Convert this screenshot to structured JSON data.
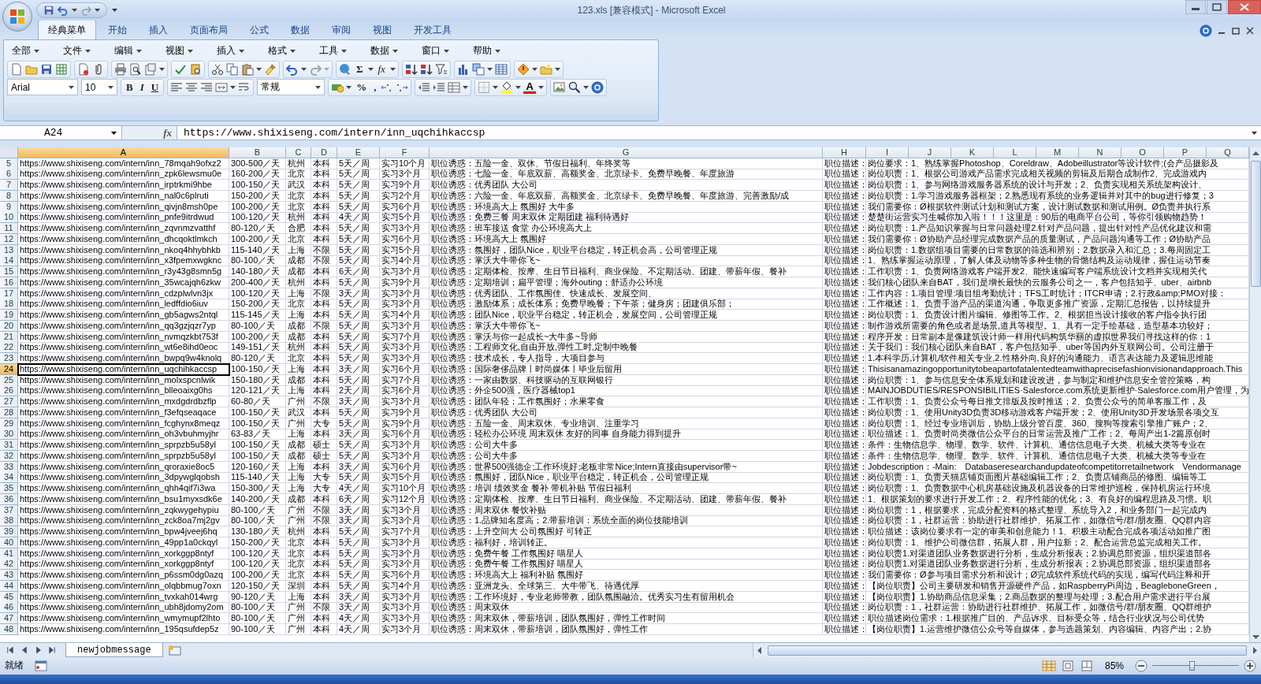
{
  "window": {
    "title": "123.xls  [兼容模式] - Microsoft Excel"
  },
  "ribbon_tabs": [
    {
      "label": "经典菜单",
      "selected": true
    },
    {
      "label": "开始",
      "selected": false
    },
    {
      "label": "插入",
      "selected": false
    },
    {
      "label": "页面布局",
      "selected": false
    },
    {
      "label": "公式",
      "selected": false
    },
    {
      "label": "数据",
      "selected": false
    },
    {
      "label": "审阅",
      "selected": false
    },
    {
      "label": "视图",
      "selected": false
    },
    {
      "label": "开发工具",
      "selected": false
    }
  ],
  "menus": [
    "全部",
    "文件",
    "编辑",
    "视图",
    "插入",
    "格式",
    "工具",
    "数据",
    "窗口",
    "帮助"
  ],
  "toolbar": {
    "sum": "Σ",
    "function": "fx",
    "font": "Arial",
    "font_size": "10",
    "bold": "B",
    "italic": "I",
    "underline": "U",
    "number_format": "常规",
    "percent": "%",
    "comma": ",",
    "font_color": "A"
  },
  "formula_bar": {
    "name_box": "A24",
    "fx": "fx",
    "formula": "https://www.shixiseng.com/intern/inn_uqchihkaccsp"
  },
  "sheet": {
    "columns": [
      {
        "label": "A",
        "selected": true
      },
      {
        "label": "B",
        "selected": false
      },
      {
        "label": "C",
        "selected": false
      },
      {
        "label": "D",
        "selected": false
      },
      {
        "label": "E",
        "selected": false
      },
      {
        "label": "F",
        "selected": false
      },
      {
        "label": "G",
        "selected": false
      },
      {
        "label": "H",
        "selected": false
      },
      {
        "label": "I",
        "selected": false
      },
      {
        "label": "J",
        "selected": false
      },
      {
        "label": "K",
        "selected": false
      },
      {
        "label": "L",
        "selected": false
      },
      {
        "label": "M",
        "selected": false
      },
      {
        "label": "N",
        "selected": false
      },
      {
        "label": "O",
        "selected": false
      },
      {
        "label": "P",
        "selected": false
      },
      {
        "label": "Q",
        "selected": false
      }
    ],
    "rows": [
      {
        "number": "5",
        "selected": false,
        "cells": [
          "https://www.shixiseng.com/intern/inn_78mqah9ofxz2",
          "300-500／天",
          "杭州",
          "本科",
          "5天／周",
          "实习10个月",
          "职位诱惑：五险一金、双休、节假日福利、年终奖等",
          "职位描述：",
          "岗位要求：1、熟练掌握Photoshop、Coreldraw、Adobeillustrator等设计软件;(会产品摄影及"
        ]
      },
      {
        "number": "6",
        "selected": false,
        "cells": [
          "https://www.shixiseng.com/intern/inn_zpk6lewsmu0e",
          "160-200／天",
          "北京",
          "本科",
          "5天／周",
          "实习3个月",
          "职位诱惑：七险一金、年底双薪、高额奖金、北京绿卡、免费早晚餐、年度旅游",
          "职位描述：",
          "岗位职责：1、根据公司游戏产品需求完成相关视频的剪辑及后期合成制作2、完成游戏内"
        ]
      },
      {
        "number": "7",
        "selected": false,
        "cells": [
          "https://www.shixiseng.com/intern/inn_irptrkmi9hbe",
          "100-150／天",
          "武汉",
          "本科",
          "5天／周",
          "实习9个月",
          "职位诱惑：优秀团队 大公司",
          "职位描述：",
          "岗位职责：1、参与网络游戏服务器系统的设计与开发；2、负责实现相关系统架构设计、"
        ]
      },
      {
        "number": "8",
        "selected": false,
        "cells": [
          "https://www.shixiseng.com/intern/inn_nal0c6plruti",
          "150-200／天",
          "北京",
          "本科",
          "5天／周",
          "实习2个月",
          "职位诱惑：六险一金、年底双薪、高额奖金、北京绿卡、免费早晚餐、年度旅游、完善激励/成",
          "职位描述：",
          "岗位职责：1.学习游戏服务器框架；2.熟悉现有系统的业务逻辑并对其中的bug进行修复；3"
        ]
      },
      {
        "number": "9",
        "selected": false,
        "cells": [
          "https://www.shixiseng.com/intern/inn_qivjn8msh0pe",
          "100-200／天",
          "北京",
          "本科",
          "5天／周",
          "实习6个月",
          "职位诱惑：环境高大上 氛围好 大牛多",
          "职位描述：",
          "我们需要你：Ø根据软件测试计划和测试方案，设计测试数据和测试用例。Ø负责并执行系"
        ]
      },
      {
        "number": "10",
        "selected": false,
        "cells": [
          "https://www.shixiseng.com/intern/inn_pnfe9itrdwud",
          "100-120／天",
          "杭州",
          "本科",
          "4天／周",
          "实习5个月",
          "职位诱惑：免费三餐 周末双休 定期团建 福利待遇好",
          "职位描述：",
          "楚楚街运营实习生喊你加入啦！！！这里是：90后的电商平台公司，等你引领购物趋势！"
        ]
      },
      {
        "number": "11",
        "selected": false,
        "cells": [
          "https://www.shixiseng.com/intern/inn_zqvnmzvatthf",
          "80-120／天",
          "合肥",
          "本科",
          "5天／周",
          "实习3个月",
          "职位诱惑：班车接送 食堂 办公环境高大上",
          "职位描述：",
          "岗位职责：1.产品知识掌握与日常问题处理2.针对产品问题，提出针对性产品优化建议和需"
        ]
      },
      {
        "number": "12",
        "selected": false,
        "cells": [
          "https://www.shixiseng.com/intern/inn_dhcqoktlmkch",
          "100-200／天",
          "北京",
          "本科",
          "5天／周",
          "实习6个月",
          "职位诱惑：环境高大上 氛围好",
          "职位描述：",
          "我们需要你：Ø协助产品经理完成数据产品的质量测试，产品问题沟通等工作；Ø协助产品"
        ]
      },
      {
        "number": "13",
        "selected": false,
        "cells": [
          "https://www.shixiseng.com/intern/inn_nkoq4hhybhkb",
          "115-140／天",
          "上海",
          "不限",
          "5天／周",
          "实习5个月",
          "职位诱惑：氛围好，团队Nice，职业平台稳定，转正机会高，公司管理正规",
          "职位描述：",
          "岗位职责：1.数据组项目需要的日常数据的筛选和辨别；2.数据录入和汇总；3.每周固定工"
        ]
      },
      {
        "number": "14",
        "selected": false,
        "cells": [
          "https://www.shixiseng.com/intern/inn_x3fpemxwgknc",
          "80-100／天",
          "成都",
          "不限",
          "5天／周",
          "实习4个月",
          "职位诱惑：掌沃大牛带你飞~",
          "职位描述：",
          "1、熟练掌握运动原理，了解人体及动物等多种生物的骨骼结构及运动规律，握住运动节奏"
        ]
      },
      {
        "number": "15",
        "selected": false,
        "cells": [
          "https://www.shixiseng.com/intern/inn_r3y43g8smn5g",
          "140-180／天",
          "成都",
          "本科",
          "6天／周",
          "实习3个月",
          "职位诱惑：定期体检、按摩、生日节日福利、商业保险、不定期活动、团建、带薪年假、餐补",
          "职位描述：",
          "工作职责：1、负责网络游戏客户端开发2、能快速编写客户端系统设计文档并实现相关代"
        ]
      },
      {
        "number": "16",
        "selected": false,
        "cells": [
          "https://www.shixiseng.com/intern/inn_35wcajqh6zkw",
          "200-400／天",
          "杭州",
          "本科",
          "5天／周",
          "实习9个月",
          "职位诱惑：定期培训；扁平管理；海外outing；舒适办公环境",
          "职位描述：",
          "我们核心团队来自BAT，我们是增长最快的云服务公司之一，客户包括知乎、uber、airbnb"
        ]
      },
      {
        "number": "17",
        "selected": false,
        "cells": [
          "https://www.shixiseng.com/intern/inn_cdzplwlvn3jx",
          "100-120／天",
          "上海",
          "不限",
          "3天／周",
          "实习3个月",
          "职位诱惑：优秀团队、工作氛围佳、快速成长、发展空间、",
          "职位描述：",
          "工作内容：1.项目管理:项目组考勤统计；TFS工时统计；ITCR申请；2.行政&amp;PMO对接："
        ]
      },
      {
        "number": "18",
        "selected": false,
        "cells": [
          "https://www.shixiseng.com/intern/inn_ledffdio6iuv",
          "150-200／天",
          "北京",
          "本科",
          "5天／周",
          "实习3个月",
          "职位诱惑：激励体系；成长体系；免费早晚餐；下午茶；健身房；团建俱乐部；",
          "职位描述：",
          "工作概述：1、负责手游产品的渠道沟通，争取更多推广资源，定期汇总报告，以持续提升"
        ]
      },
      {
        "number": "19",
        "selected": false,
        "cells": [
          "https://www.shixiseng.com/intern/inn_gb5agws2ntql",
          "115-145／天",
          "上海",
          "本科",
          "5天／周",
          "实习4个月",
          "职位诱惑：团队Nice，职业平台稳定，转正机会，发展空间，公司管理正规",
          "职位描述：",
          "岗位职责：1、负责设计图片编辑、修图等工作。2、根据担当设计接收的客户指令执行团"
        ]
      },
      {
        "number": "20",
        "selected": false,
        "cells": [
          "https://www.shixiseng.com/intern/inn_qq3gzjqzr7yp",
          "80-100／天",
          "成都",
          "不限",
          "5天／周",
          "实习3个月",
          "职位诱惑：掌沃大牛带你飞~",
          "职位描述：",
          "制作游戏所需要的角色或者是场景,道具等模型。1、具有一定手绘基础，造型基本功较好；"
        ]
      },
      {
        "number": "21",
        "selected": false,
        "cells": [
          "https://www.shixiseng.com/intern/inn_nvmqzkbt753f",
          "100-200／天",
          "成都",
          "本科",
          "5天／周",
          "实习7个月",
          "职位诱惑：掌沃与你一起成长~大牛多~导师",
          "职位描述：",
          "程序开发：日常副本是像建筑设计师一样用代码构筑华丽的虚拟世界我们寻找这样的你：1"
        ]
      },
      {
        "number": "22",
        "selected": false,
        "cells": [
          "https://www.shixiseng.com/intern/inn_wt6e8ihd0eoc",
          "149-151／天",
          "杭州",
          "本科",
          "5天／周",
          "实习3个月",
          "职位诱惑：工程师文化,自由开放,弹性工时,定制中晚餐",
          "职位描述：",
          "关于我们：我们核心团队来自BAT，客户包括知乎、uber等国内外互联网公司。公司注册于"
        ]
      },
      {
        "number": "23",
        "selected": false,
        "cells": [
          "https://www.shixiseng.com/intern/inn_bwpq9w4knolq",
          "80-120／天",
          "北京",
          "本科",
          "5天／周",
          "实习3个月",
          "职位诱惑：技术成长，专人指导，大项目参与",
          "职位描述：",
          "1.本科学历,计算机/软件相关专业,2.性格外向,良好的沟通能力、语言表达能力及逻辑思维能"
        ]
      },
      {
        "number": "24",
        "selected": true,
        "cells": [
          "https://www.shixiseng.com/intern/inn_uqchihkaccsp",
          "100-150／天",
          "上海",
          "本科",
          "3天／周",
          "实习6个月",
          "职位诱惑：国际奢侈品牌丨时尚媒体丨毕业后留用",
          "职位描述：",
          "Thisisanamazingopportunitytobeapartofatalentedteamwithaprecisefashionvisionandapproach.This"
        ]
      },
      {
        "number": "25",
        "selected": false,
        "cells": [
          "https://www.shixiseng.com/intern/inn_molxspcnlwik",
          "150-180／天",
          "成都",
          "本科",
          "5天／周",
          "实习7个月",
          "职位诱惑：一家由数据、科技驱动的互联网银行",
          "职位描述：",
          "岗位职责：1、参与信息安全体系规划和建设改进，参与制定和维护信息安全管控策略，构"
        ]
      },
      {
        "number": "26",
        "selected": false,
        "cells": [
          "https://www.shixiseng.com/intern/inn_blleoaixg0hs",
          "120-121／天",
          "上海",
          "本科",
          "2天／周",
          "实习6个月",
          "职位诱惑：外企500强，医疗器械top1",
          "职位描述：",
          "MAINJOBDUTIES/RESPONSIBILITIES·Salesforce.com系统更新维护·Salesforce.com用户管理，为"
        ]
      },
      {
        "number": "27",
        "selected": false,
        "cells": [
          "https://www.shixiseng.com/intern/inn_mxdgdrdbzflp",
          "60-80／天",
          "广州",
          "不限",
          "3天／周",
          "实习3个月",
          "职位诱惑：团队年轻；工作氛围好；水果零食",
          "职位描述：",
          "工作职责：1、负责公众号每日推文排版及按时推送；2、负责公众号的简单客服工作，及"
        ]
      },
      {
        "number": "28",
        "selected": false,
        "cells": [
          "https://www.shixiseng.com/intern/inn_f3efqseaqace",
          "100-150／天",
          "武汉",
          "本科",
          "5天／周",
          "实习9个月",
          "职位诱惑：优秀团队 大公司",
          "职位描述：",
          "岗位职责：1、使用Unity3D负责3D移动游戏客户端开发；2、使用Unity3D开发场景各项交互"
        ]
      },
      {
        "number": "29",
        "selected": false,
        "cells": [
          "https://www.shixiseng.com/intern/inn_fcghynx8meqz",
          "100-150／天",
          "广州",
          "大专",
          "5天／周",
          "实习9个月",
          "职位诱惑：五险一金、周末双休、专业培训、注重学习",
          "职位描述：",
          "岗位职责：1、经过专业培训后，协助上级分管百度、360、搜狗等搜索引擎推广账户；2、"
        ]
      },
      {
        "number": "30",
        "selected": false,
        "cells": [
          "https://www.shixiseng.com/intern/inn_oh3vbuhmyjhr",
          "63-83／天",
          "上海",
          "本科",
          "3天／周",
          "实习6个月",
          "职位诱惑：轻松办公环境 周末双休 友好的同事 自身能力得到提升",
          "职位描述：",
          "职位描述：1、负责时尚类微信公众平台的日常运营及推广工作；2、每周产出1-2篇原创时"
        ]
      },
      {
        "number": "31",
        "selected": false,
        "cells": [
          "https://www.shixiseng.com/intern/inn_sprpzb5u58yl",
          "100-150／天",
          "成都",
          "硕士",
          "5天／周",
          "实习3个月",
          "职位诱惑：公司大牛多",
          "职位描述：",
          "条件：生物信息学、物理、数学、软件、计算机、通信信息电子大类、机械大类等专业在"
        ]
      },
      {
        "number": "32",
        "selected": false,
        "cells": [
          "https://www.shixiseng.com/intern/inn_sprpzb5u58yl",
          "100-150／天",
          "成都",
          "硕士",
          "5天／周",
          "实习3个月",
          "职位诱惑：公司大牛多",
          "职位描述：",
          "条件：生物信息学、物理、数学、软件、计算机、通信信息电子大类、机械大类等专业在"
        ]
      },
      {
        "number": "33",
        "selected": false,
        "cells": [
          "https://www.shixiseng.com/intern/inn_qroraxie8oc5",
          "120-160／天",
          "上海",
          "本科",
          "3天／周",
          "实习6个月",
          "职位诱惑：世界500强德企;工作环境好;老板非常Nice;Intern直接由supervisor带~",
          "职位描述：",
          "Jobdescription：-Main:　Databaseresearchandupdateofcompetitorretailnetwork　Vendormanage"
        ]
      },
      {
        "number": "34",
        "selected": false,
        "cells": [
          "https://www.shixiseng.com/intern/inn_3dpywglqobsh",
          "115-140／天",
          "上海",
          "大专",
          "5天／周",
          "实习5个月",
          "职位诱惑：氛围好，团队Nice，职业平台稳定，转正机会，公司管理正规",
          "职位描述：",
          "岗位职责：1、负责天猫店铺页面图片基础编辑工作；2、负责店铺商品的修图、编辑等工"
        ]
      },
      {
        "number": "35",
        "selected": false,
        "cells": [
          "https://www.shixiseng.com/intern/inn_qhh4qif7i3wa",
          "150-300／天",
          "上海",
          "大专",
          "4天／周",
          "实习10个月",
          "职位诱惑：培训 绩效奖金 餐补 带机补贴 节假日福利",
          "职位描述：",
          "岗位职责：1、负责数据中心机房基础设施及机器设备的日常维护巡检，保持机房运行环境"
        ]
      },
      {
        "number": "36",
        "selected": false,
        "cells": [
          "https://www.shixiseng.com/intern/inn_bsu1myxsdk6e",
          "140-200／天",
          "成都",
          "本科",
          "6天／周",
          "实习12个月",
          "职位诱惑：定期体检、按摩、生日节日福利、商业保险、不定期活动、团建、带薪年假、餐补",
          "职位描述：",
          "1、根据策划的要求进行开发工作；2、程序性能的优化；3、有良好的编程思路及习惯。职"
        ]
      },
      {
        "number": "37",
        "selected": false,
        "cells": [
          "https://www.shixiseng.com/intern/inn_zqkwygehypiu",
          "80-100／天",
          "广州",
          "不限",
          "3天／周",
          "实习3个月",
          "职位诱惑：周末双休 餐饮补贴",
          "职位描述：",
          "岗位职责：1，根据要求，完成分配资料的格式整理、系统导入2，和业务部门一起完成内"
        ]
      },
      {
        "number": "38",
        "selected": false,
        "cells": [
          "https://www.shixiseng.com/intern/inn_zck8oa7mj2gv",
          "80-100／天",
          "广州",
          "不限",
          "3天／周",
          "实习3个月",
          "职位诱惑：1.品牌知名度高；2.带薪培训：系统全面的岗位技能培训",
          "职位描述：",
          "岗位职责：1，社群运营：协助进行社群维护、拓展工作，如微信号/群/朋友圈、QQ群内容"
        ]
      },
      {
        "number": "39",
        "selected": false,
        "cells": [
          "https://www.shixiseng.com/intern/inn_bpw4jveej6hq",
          "130-180／天",
          "杭州",
          "本科",
          "5天／周",
          "实习7个月",
          "职位诱惑：上升空间大 公司氛围好 可转正",
          "职位描述：",
          "职位描述：该岗位要求有一定的审美和创意能力！1、积极主动配合完成各项活动如推广图"
        ]
      },
      {
        "number": "40",
        "selected": false,
        "cells": [
          "https://www.shixiseng.com/intern/inn_49pp1a0ckqyl",
          "150-200／天",
          "北京",
          "本科",
          "5天／周",
          "实习3个月",
          "职位诱惑：福利好，培训转正。",
          "职位描述：",
          "岗位职责：1、维护公司微信群，拓展人群，用户拉新；2、配合运营总监完成相关工作。"
        ]
      },
      {
        "number": "41",
        "selected": false,
        "cells": [
          "https://www.shixiseng.com/intern/inn_xorkggp8ntyf",
          "100-120／天",
          "北京",
          "本科",
          "5天／周",
          "实习3个月",
          "职位诱惑：免费午餐 工作氛围好 喵星人",
          "职位描述：",
          "岗位职责1.对渠道团队业务数据进行分析，生成分析报表；2.协调总部资源，组织渠道部各"
        ]
      },
      {
        "number": "42",
        "selected": false,
        "cells": [
          "https://www.shixiseng.com/intern/inn_xorkggp8ntyf",
          "100-120／天",
          "北京",
          "本科",
          "5天／周",
          "实习3个月",
          "职位诱惑：免费午餐 工作氛围好 喵星人",
          "职位描述：",
          "岗位职责1.对渠道团队业务数据进行分析，生成分析报表；2.协调总部资源，组织渠道部各"
        ]
      },
      {
        "number": "43",
        "selected": false,
        "cells": [
          "https://www.shixiseng.com/intern/inn_p6ssm0dg0azq",
          "100-200／天",
          "北京",
          "本科",
          "5天／周",
          "实习6个月",
          "职位诱惑：环境高大上 福利补贴 氛围好",
          "职位描述：",
          "我们需要你：Ø参与项目需求分析和设计；Ø完成软件系统代码的实现，编写代码注释和开"
        ]
      },
      {
        "number": "44",
        "selected": false,
        "cells": [
          "https://www.shixiseng.com/intern/inn_olqbbmug7oxn",
          "120-150／天",
          "深圳",
          "本科",
          "5天／周",
          "实习4个月",
          "职位诱惑：亚洲龙头、全球第三、大牛带飞、待遇优厚",
          "职位描述：",
          "【岗位职责】公司主要研发和销售开源硬件产品，如RaspberryPi周边，BeagleboneGreen，"
        ]
      },
      {
        "number": "45",
        "selected": false,
        "cells": [
          "https://www.shixiseng.com/intern/inn_tvxkah014wrg",
          "90-120／天",
          "上海",
          "本科",
          "3天／周",
          "实习3个月",
          "职位诱惑：工作环境好，专业老师带教，团队氛围融洽。优秀实习生有留用机会",
          "职位描述：",
          "【岗位职责】1.协助商品信息采集；2.商品数据的整理与处理；3.配合用户需求进行平台展"
        ]
      },
      {
        "number": "46",
        "selected": false,
        "cells": [
          "https://www.shixiseng.com/intern/inn_ubh8jdomy2om",
          "80-100／天",
          "广州",
          "不限",
          "3天／周",
          "实习3个月",
          "职位诱惑：周末双休",
          "职位描述：",
          "岗位职责：1，社群运营：协助进行社群维护、拓展工作，如微信号/群/朋友圈、QQ群维护"
        ]
      },
      {
        "number": "47",
        "selected": false,
        "cells": [
          "https://www.shixiseng.com/intern/inn_wmymupf2lhto",
          "80-100／天",
          "广州",
          "本科",
          "4天／周",
          "实习3个月",
          "职位诱惑：周末双休，带薪培训，团队氛围好，弹性工作时间",
          "职位描述：",
          "职位描述岗位需求：1.根据推广目的、产品诉求、目标受众等，结合行业状况与公司优势"
        ]
      },
      {
        "number": "48",
        "selected": false,
        "cells": [
          "https://www.shixiseng.com/intern/inn_195qsufdep5z",
          "90-100／天",
          "广州",
          "本科",
          "4天／周",
          "实习3个月",
          "职位诱惑：周末双休，带薪培训，团队氛围好，弹性工作",
          "职位描述：",
          "【岗位职责】1.运营维护微信公众号等自媒体，参与选题策划、内容编辑、内容产出；2.协"
        ]
      }
    ]
  },
  "sheet_tabs": [
    {
      "label": "newjobmessage",
      "selected": true
    }
  ],
  "status_bar": {
    "text": "就绪",
    "zoom": "85%",
    "zoom_slider": {
      "level": 0.45
    }
  }
}
